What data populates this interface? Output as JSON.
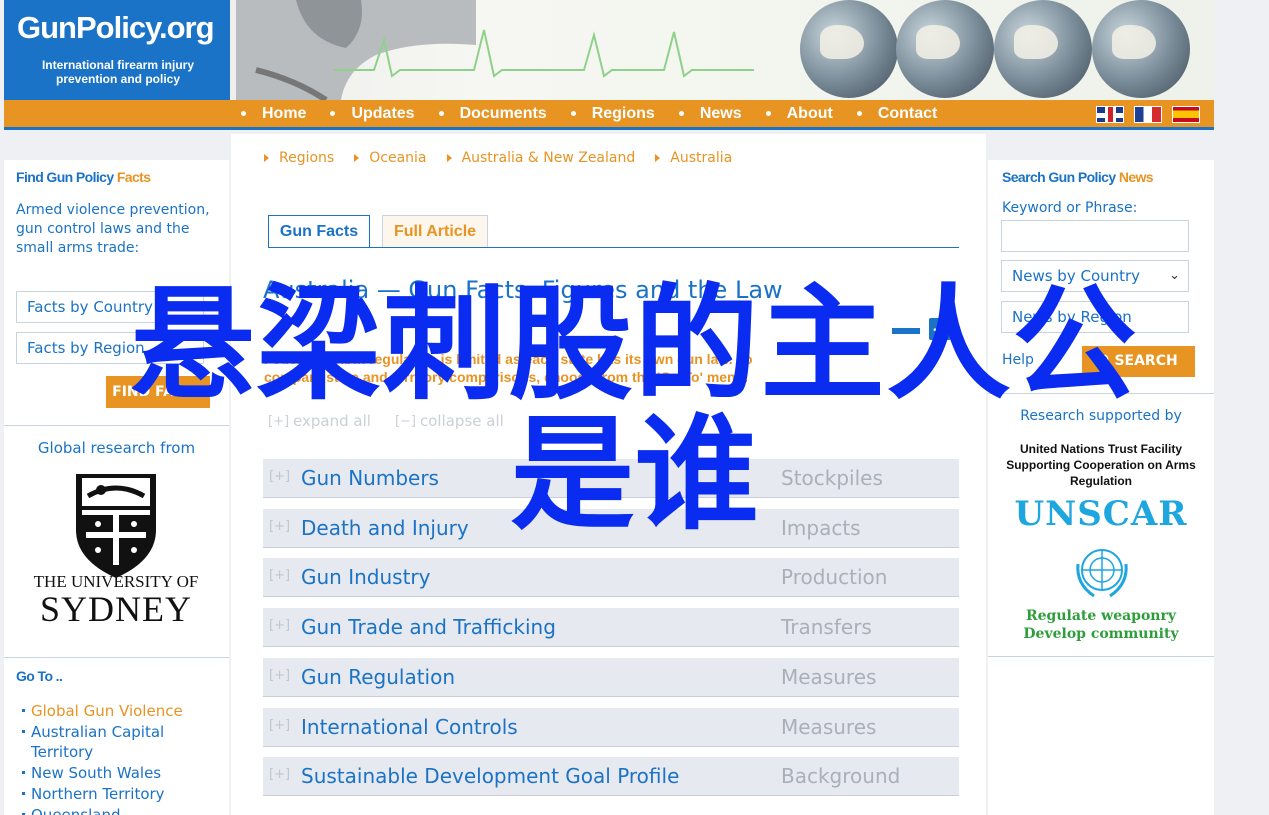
{
  "header": {
    "logo_main": "GunPolicy.org",
    "logo_sub": "International firearm injury prevention and policy"
  },
  "nav": {
    "items": [
      "Home",
      "Updates",
      "Documents",
      "Regions",
      "News",
      "About",
      "Contact"
    ]
  },
  "flags": [
    "uk-flag-icon",
    "france-flag-icon",
    "spain-flag-icon"
  ],
  "left": {
    "find_title": "Find Gun Policy",
    "find_title_accent": "Facts",
    "find_desc": "Armed violence prevention, gun control laws and the small arms trade:",
    "select_country": "Facts by Country",
    "select_region": "Facts by Region",
    "find_button": "FIND FACTS",
    "global_research": "Global research from",
    "usyd_line1": "THE UNIVERSITY OF",
    "usyd_line2": "SYDNEY",
    "goto_title": "Go To ..",
    "goto_items": [
      "Global Gun Violence",
      "Australian Capital Territory",
      "New South Wales",
      "Northern Territory",
      "Queensland"
    ]
  },
  "breadcrumb": [
    "Regions",
    "Oceania",
    "Australia & New Zealand",
    "Australia"
  ],
  "tabs": {
    "gun_facts": "Gun Facts",
    "full_article": "Full Article"
  },
  "main": {
    "title": "Australia — Gun Facts, Figures and the Law",
    "intro": "Federal firearm regulation is limited as each state has its own gun law. To compare state and territory comparisons, choose from the 'Go To' menu.",
    "expand_all": "expand all",
    "collapse_all": "collapse all",
    "categories": [
      {
        "name": "Gun Numbers",
        "tag": "Stockpiles"
      },
      {
        "name": "Death and Injury",
        "tag": "Impacts"
      },
      {
        "name": "Gun Industry",
        "tag": "Production"
      },
      {
        "name": "Gun Trade and Trafficking",
        "tag": "Transfers"
      },
      {
        "name": "Gun Regulation",
        "tag": "Measures"
      },
      {
        "name": "International Controls",
        "tag": "Measures"
      },
      {
        "name": "Sustainable Development Goal Profile",
        "tag": "Background"
      }
    ]
  },
  "right": {
    "search_title": "Search Gun Policy",
    "search_title_accent": "News",
    "keyword_label": "Keyword or Phrase:",
    "keyword_value": "",
    "news_country": "News by Country",
    "news_region": "News by Region",
    "help": "Help",
    "search_button": "SEARCH",
    "research_label": "Research supported by",
    "un_facility": "United Nations Trust Facility Supporting Cooperation on Arms Regulation",
    "unscar_name": "UNSCAR",
    "unscar_tag1": "Regulate weaponry",
    "unscar_tag2": "Develop community"
  },
  "overlay": {
    "line1": "悬梁刺股的主人公",
    "line2": "是谁"
  },
  "colors": {
    "brand_blue": "#1a73c6",
    "brand_orange": "#e79423",
    "overlay_blue": "#0a2bf0"
  }
}
